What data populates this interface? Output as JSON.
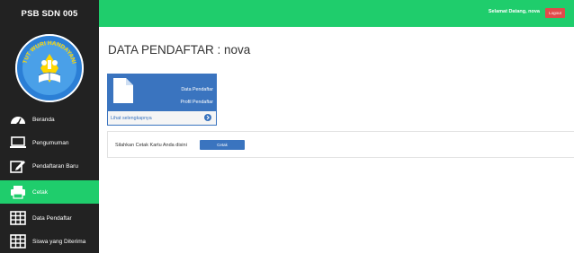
{
  "app": {
    "brand": "PSB SDN 005",
    "welcome": "Selamat Datang, nova",
    "logout_label": "Logout"
  },
  "logo": {
    "arc_text": "TUT WURI HANDAYANI"
  },
  "sidebar": {
    "items": [
      {
        "label": "Beranda",
        "icon": "dashboard-icon"
      },
      {
        "label": "Pengumuman",
        "icon": "monitor-icon"
      },
      {
        "label": "Pendaftaran Baru",
        "icon": "edit-icon"
      },
      {
        "label": "Cetak",
        "icon": "printer-icon",
        "active": true
      },
      {
        "label": "Data Pendaftar",
        "icon": "table-icon"
      },
      {
        "label": "Siswa yang Diterima",
        "icon": "table-icon"
      }
    ]
  },
  "main": {
    "title": "DATA PENDAFTAR : nova",
    "panel": {
      "line1": "Data Pendaftar",
      "line2": "Profil Pendaftar",
      "link": "Lihat selengkapnya"
    },
    "print": {
      "text": "Silahkan Cetak Kartu Anda disini",
      "button": "Cetak"
    }
  },
  "colors": {
    "sidebar_bg": "#222222",
    "accent_green": "#1fcd6c",
    "primary_blue": "#3a74bf",
    "logout_red": "#e04a4a"
  }
}
